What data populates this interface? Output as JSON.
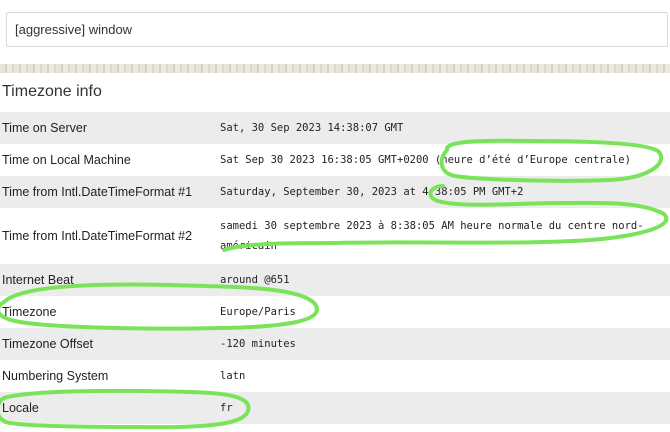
{
  "input": {
    "value": "[aggressive] window"
  },
  "section": {
    "title": "Timezone info"
  },
  "rows": [
    {
      "label": "Time on Server",
      "value": "Sat, 30 Sep 2023 14:38:07 GMT"
    },
    {
      "label": "Time on Local Machine",
      "value": "Sat Sep 30 2023 16:38:05 GMT+0200 (heure d’été d’Europe centrale)"
    },
    {
      "label": "Time from Intl.DateTimeFormat #1",
      "value": "Saturday, September 30, 2023 at 4:38:05 PM GMT+2"
    },
    {
      "label": "Time from Intl.DateTimeFormat #2",
      "value": "samedi 30 septembre 2023 à 8:38:05 AM heure normale du centre nord-américain"
    },
    {
      "label": "Internet Beat",
      "value": "around @651"
    },
    {
      "label": "Timezone",
      "value": "Europe/Paris"
    },
    {
      "label": "Timezone Offset",
      "value": "-120 minutes"
    },
    {
      "label": "Numbering System",
      "value": "latn"
    },
    {
      "label": "Locale",
      "value": "fr"
    }
  ],
  "annotations": {
    "highlight_color": "#7be35a"
  }
}
